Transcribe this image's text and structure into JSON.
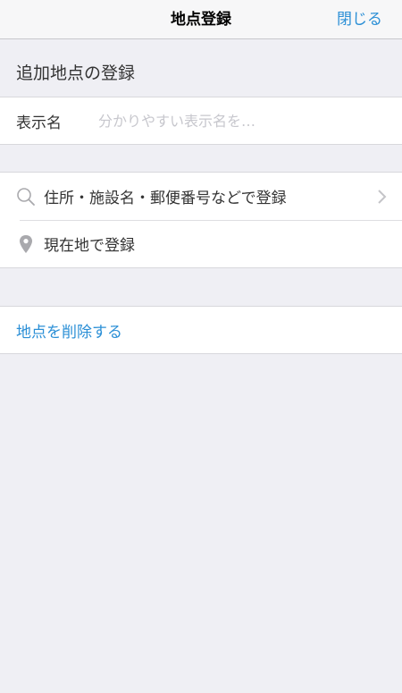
{
  "navbar": {
    "title": "地点登録",
    "close_label": "閉じる"
  },
  "section": {
    "header": "追加地点の登録"
  },
  "name_field": {
    "label": "表示名",
    "value": "",
    "placeholder": "分かりやすい表示名を…"
  },
  "register_options": {
    "search": {
      "icon": "search-icon",
      "label": "住所・施設名・郵便番号などで登録"
    },
    "current_location": {
      "icon": "location-pin-icon",
      "label": "現在地で登録"
    }
  },
  "delete": {
    "label": "地点を削除する"
  },
  "colors": {
    "accent": "#2b8fd6",
    "background": "#efeff4",
    "icon_gray": "#a9a9ad",
    "placeholder": "#c7c7cd"
  }
}
